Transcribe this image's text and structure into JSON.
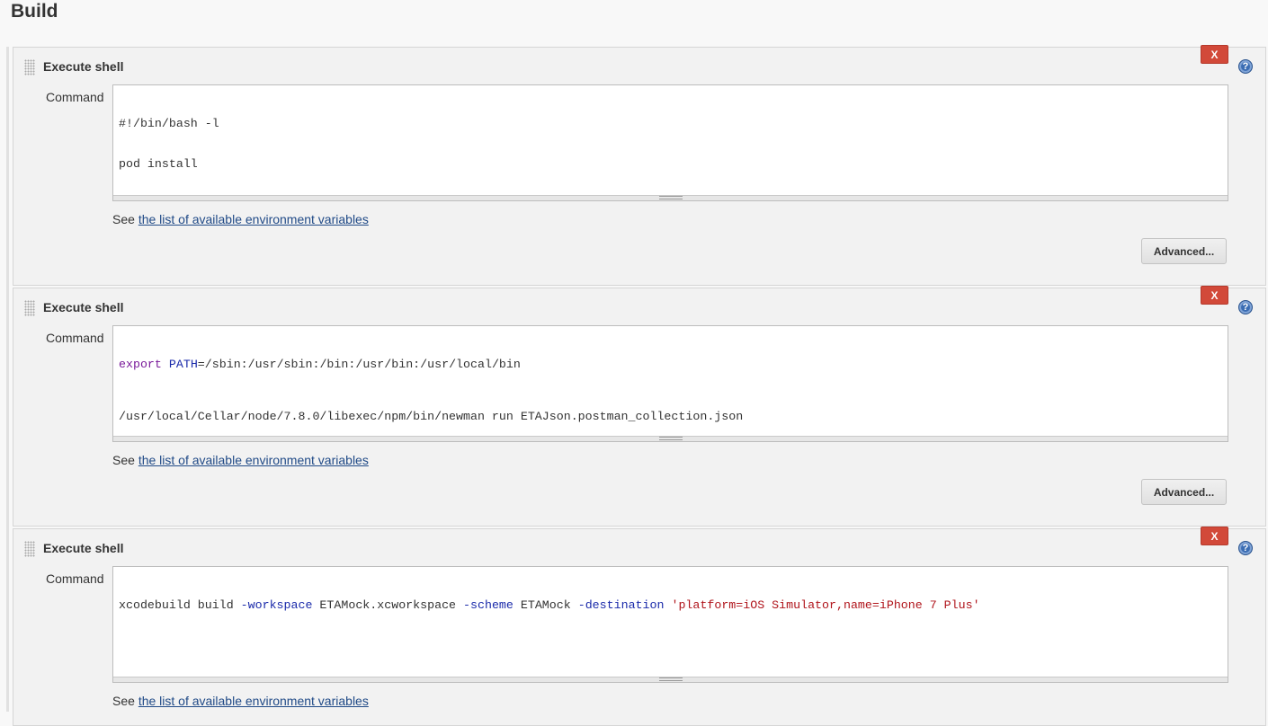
{
  "section": {
    "title": "Build"
  },
  "steps": [
    {
      "title": "Execute shell",
      "delete_label": "X",
      "command_label": "Command",
      "command_lines": [
        "#!/bin/bash -l",
        "pod install"
      ],
      "env_prefix": "See",
      "env_link": "the list of available environment variables",
      "advanced_label": "Advanced..."
    },
    {
      "title": "Execute shell",
      "delete_label": "X",
      "command_label": "Command",
      "command_line1": {
        "kw": "export",
        "var": "PATH",
        "rest": "=/sbin:/usr/sbin:/bin:/usr/bin:/usr/local/bin"
      },
      "command_line2": "/usr/local/Cellar/node/7.8.0/libexec/npm/bin/newman run ETAJson.postman_collection.json",
      "env_prefix": "See",
      "env_link": "the list of available environment variables",
      "advanced_label": "Advanced..."
    },
    {
      "title": "Execute shell",
      "delete_label": "X",
      "command_label": "Command",
      "command_parts": {
        "p1": "xcodebuild build ",
        "opt1": "-workspace",
        "p2": " ETAMock.xcworkspace ",
        "opt2": "-scheme",
        "p3": " ETAMock ",
        "opt3": "-destination",
        "p4": " ",
        "str": "'platform=iOS Simulator,name=iPhone 7 Plus'"
      },
      "env_prefix": "See",
      "env_link": "the list of available environment variables"
    }
  ],
  "icons": {
    "help": "help-icon",
    "grip": "drag-handle-icon"
  },
  "colors": {
    "delete": "#d24939",
    "link": "#204a87",
    "help": "#3b6db3"
  }
}
